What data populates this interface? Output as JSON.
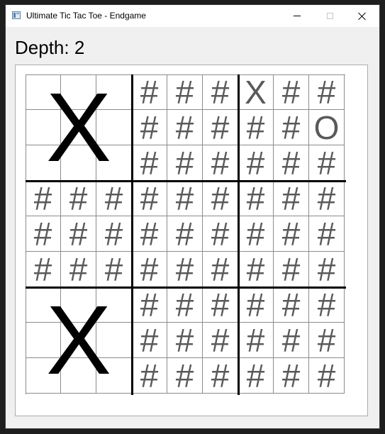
{
  "window": {
    "title": "Ultimate Tic Tac Toe - Endgame"
  },
  "icons": {
    "app": "app-window-icon",
    "minimize": "minimize-icon",
    "maximize": "maximize-icon",
    "close": "close-icon"
  },
  "depth_label": "Depth: 2",
  "board": {
    "subboards": [
      {
        "won": "X",
        "cells": [
          "",
          "",
          "",
          "",
          "",
          "",
          "",
          "",
          ""
        ]
      },
      {
        "won": "",
        "cells": [
          "#",
          "#",
          "#",
          "#",
          "#",
          "#",
          "#",
          "#",
          "#"
        ]
      },
      {
        "won": "",
        "cells": [
          "X",
          "#",
          "#",
          "#",
          "#",
          "O",
          "#",
          "#",
          "#"
        ]
      },
      {
        "won": "",
        "cells": [
          "#",
          "#",
          "#",
          "#",
          "#",
          "#",
          "#",
          "#",
          "#"
        ]
      },
      {
        "won": "",
        "cells": [
          "#",
          "#",
          "#",
          "#",
          "#",
          "#",
          "#",
          "#",
          "#"
        ]
      },
      {
        "won": "",
        "cells": [
          "#",
          "#",
          "#",
          "#",
          "#",
          "#",
          "#",
          "#",
          "#"
        ]
      },
      {
        "won": "X",
        "cells": [
          "",
          "",
          "",
          "",
          "",
          "",
          "",
          "",
          ""
        ]
      },
      {
        "won": "",
        "cells": [
          "#",
          "#",
          "#",
          "#",
          "#",
          "#",
          "#",
          "#",
          "#"
        ]
      },
      {
        "won": "",
        "cells": [
          "#",
          "#",
          "#",
          "#",
          "#",
          "#",
          "#",
          "#",
          "#"
        ]
      }
    ]
  }
}
